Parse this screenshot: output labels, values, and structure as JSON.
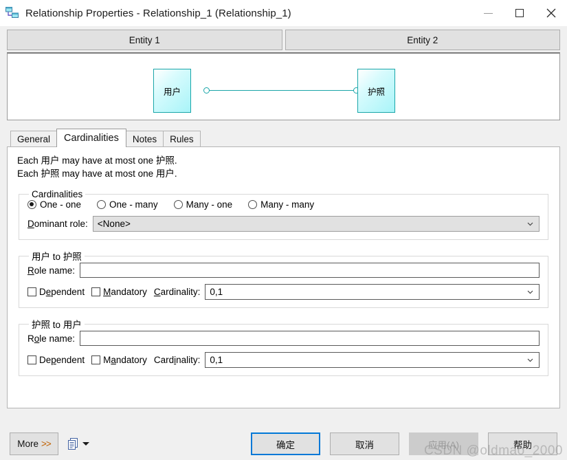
{
  "window": {
    "title": "Relationship Properties - Relationship_1 (Relationship_1)",
    "icon": "relationship-icon",
    "controls": {
      "minimize": "minimize-icon",
      "maximize": "maximize-icon",
      "close": "close-icon"
    }
  },
  "entity_headers": [
    {
      "label": "Entity 1"
    },
    {
      "label": "Entity 2"
    }
  ],
  "diagram": {
    "left_entity": "用户",
    "right_entity": "护照",
    "connector_color": "#18a5a8",
    "entity_fill": "#a8f4f8"
  },
  "tabs": [
    {
      "label": "General",
      "active": false
    },
    {
      "label": "Cardinalities",
      "active": true
    },
    {
      "label": "Notes",
      "active": false
    },
    {
      "label": "Rules",
      "active": false
    }
  ],
  "cardinalities_page": {
    "description": [
      "Each 用户 may have at most one 护照.",
      "Each 护照 may have at most one 用户."
    ],
    "cardinalities_group": {
      "legend": "Cardinalities",
      "options": [
        {
          "label": "One - one",
          "selected": true
        },
        {
          "label": "One - many",
          "selected": false
        },
        {
          "label": "Many - one",
          "selected": false
        },
        {
          "label": "Many - many",
          "selected": false
        }
      ],
      "dominant_role": {
        "label_pre": "D",
        "label_post": "ominant role:",
        "value": "<None>",
        "enabled": false
      }
    },
    "role_groups": [
      {
        "legend": "用户 to 护照",
        "role_name": {
          "label_pre": "R",
          "label_post": "ole name:",
          "value": "",
          "placeholder": ""
        },
        "dependent": {
          "label_pre": "D",
          "label_acc": "e",
          "label_post": "pendent",
          "checked": false
        },
        "mandatory": {
          "label_pre": "",
          "label_acc": "M",
          "label_post": "andatory",
          "checked": false
        },
        "cardinality": {
          "label_pre": "",
          "label_acc": "C",
          "label_post": "ardinality:",
          "value": "0,1"
        }
      },
      {
        "legend": "护照 to 用户",
        "role_name": {
          "label_pre": "R",
          "label_post": "ole name:",
          "value": "",
          "placeholder": ""
        },
        "dependent": {
          "label_pre": "De",
          "label_acc": "p",
          "label_post": "endent",
          "checked": false
        },
        "mandatory": {
          "label_pre": "M",
          "label_acc": "a",
          "label_post": "ndatory",
          "checked": false
        },
        "cardinality": {
          "label_pre": "Card",
          "label_acc": "i",
          "label_post": "nality:",
          "value": "0,1"
        }
      }
    ]
  },
  "bottom_bar": {
    "more_label": "More",
    "more_chevrons": ">>",
    "report_icon": "report-icon",
    "report_dropdown": "chevron-down-icon",
    "ok_label": "确定",
    "cancel_label": "取消",
    "apply_label": "应用(A)",
    "apply_enabled": false,
    "help_label": "帮助"
  },
  "watermark": "CSDN @oldmao_2000"
}
